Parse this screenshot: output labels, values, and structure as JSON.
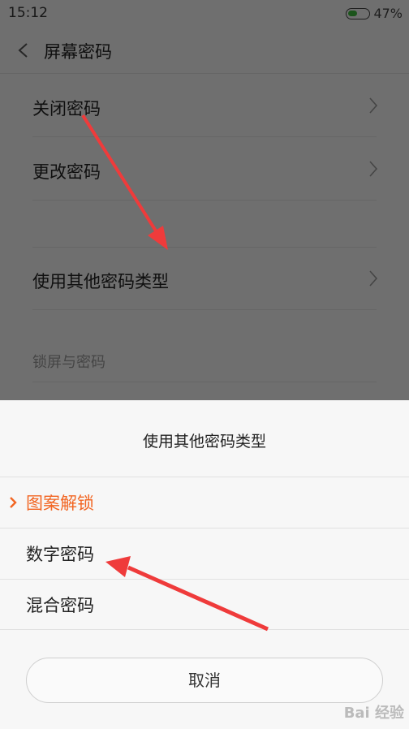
{
  "status_bar": {
    "time": "15:12",
    "battery_percent": "47%",
    "battery_level": 0.47
  },
  "header": {
    "title": "屏幕密码"
  },
  "list": {
    "items": [
      {
        "label": "关闭密码"
      },
      {
        "label": "更改密码"
      },
      {
        "label": "使用其他密码类型"
      }
    ],
    "section_label": "锁屏与密码"
  },
  "sheet": {
    "title": "使用其他密码类型",
    "options": [
      {
        "label": "图案解锁",
        "selected": true
      },
      {
        "label": "数字密码",
        "selected": false
      },
      {
        "label": "混合密码",
        "selected": false
      }
    ],
    "cancel_label": "取消"
  },
  "watermark": {
    "text": "Bai 经验"
  },
  "colors": {
    "accent": "#f26522",
    "annotation_arrow": "#ef3b3b",
    "battery": "#3dba3d"
  }
}
